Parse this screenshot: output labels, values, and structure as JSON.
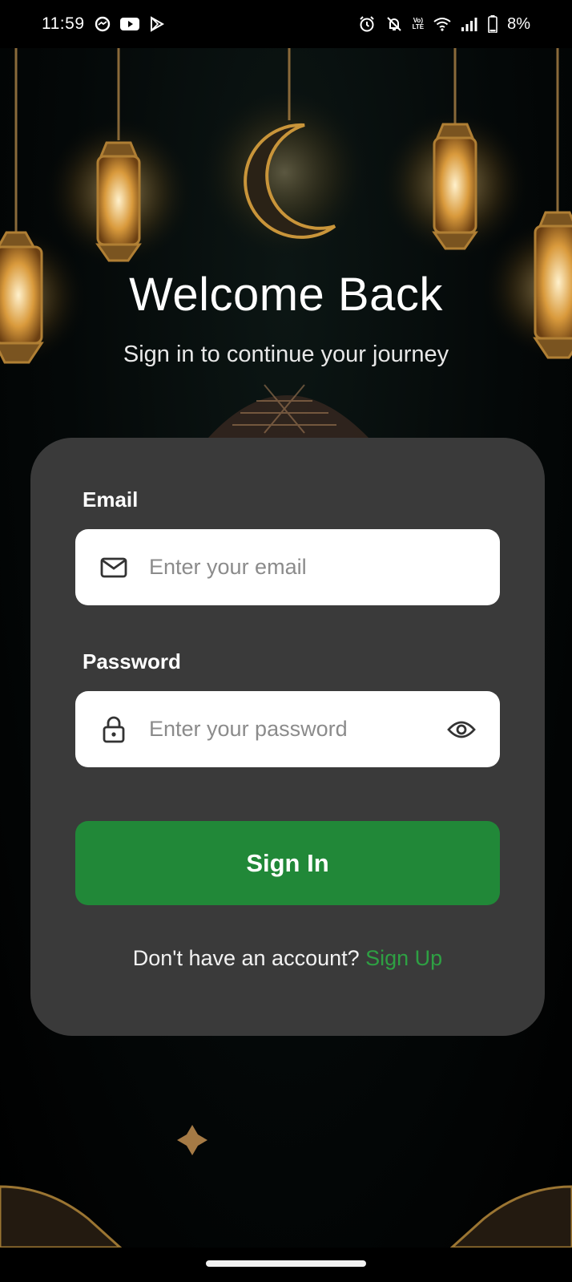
{
  "status_bar": {
    "time": "11:59",
    "battery": "8%",
    "volte_line1": "Vo)",
    "volte_line2": "LTE",
    "left_icons": [
      "messenger-icon",
      "youtube-icon",
      "play-store-icon"
    ],
    "right_icons": [
      "alarm-icon",
      "bell-off-icon",
      "volte-icon",
      "wifi-icon",
      "signal-icon",
      "battery-icon"
    ]
  },
  "hero": {
    "title": "Welcome Back",
    "subtitle": "Sign in to continue your journey"
  },
  "form": {
    "email_label": "Email",
    "email_placeholder": "Enter your email",
    "password_label": "Password",
    "password_placeholder": "Enter your password",
    "signin_label": "Sign In",
    "signup_prompt": "Don't have an account?",
    "signup_link": "Sign Up"
  },
  "colors": {
    "card": "#3a3a3a",
    "primary_green": "#218838",
    "link_green": "#2ea043",
    "lantern_gold": "#c9953a"
  }
}
